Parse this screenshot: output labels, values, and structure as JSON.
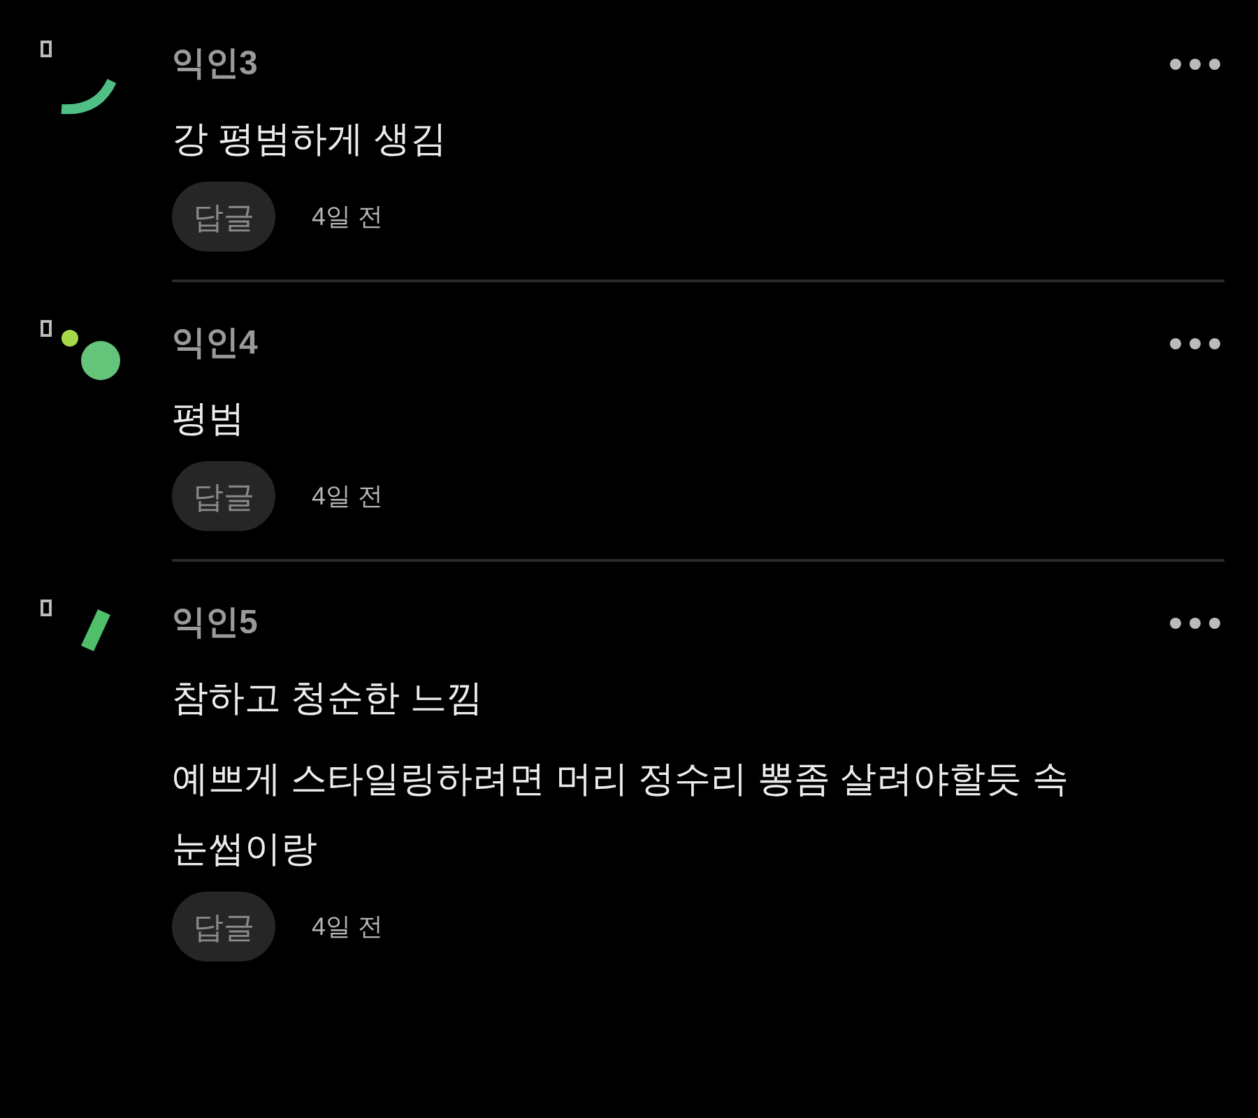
{
  "comments": [
    {
      "author": "익인3",
      "avatar": {
        "kind": "arc"
      },
      "lines": [
        "강 평범하게 생김"
      ],
      "reply": "답글",
      "time": "4일 전"
    },
    {
      "author": "익인4",
      "avatar": {
        "kind": "dots"
      },
      "lines": [
        "평범"
      ],
      "reply": "답글",
      "time": "4일 전"
    },
    {
      "author": "익인5",
      "avatar": {
        "kind": "bar"
      },
      "lines": [
        "참하고 청순한 느낌",
        "예쁘게 스타일링하려면 머리 정수리 뽕좀 살려야할듯 속 눈썹이랑"
      ],
      "reply": "답글",
      "time": "4일 전"
    }
  ]
}
